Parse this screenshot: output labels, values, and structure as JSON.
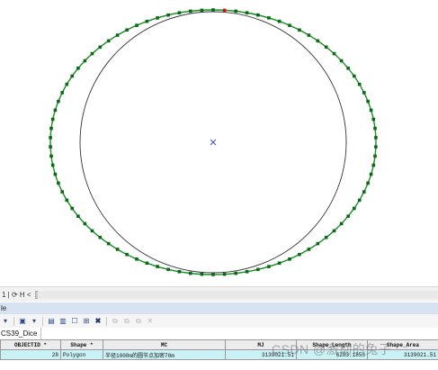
{
  "map": {
    "outer_color": "#1f8c2a",
    "inner_color": "#333333",
    "vertex_color": "#0b6b14",
    "selected_vertex_color": "#e01010",
    "center_marker_color": "#3b45b3"
  },
  "status": {
    "text": "1 | ⟳ H  <"
  },
  "table_window": {
    "title": "le"
  },
  "toolbar": {
    "delete_glyph": "✖",
    "delete_disabled_glyph": "✕"
  },
  "tab": {
    "label": "CS39_Dice"
  },
  "attribute_table": {
    "columns": [
      "OBJECTID *",
      "Shape *",
      "MC",
      "MJ",
      "Shape_Length",
      "Shape_Area"
    ],
    "rows": [
      [
        "28",
        "Polygon",
        "半径1000m的圆节点加密70m",
        "3139021.51",
        "6283.1853",
        "3139021.51"
      ]
    ]
  },
  "watermark": "CSDN @激动的兔子"
}
